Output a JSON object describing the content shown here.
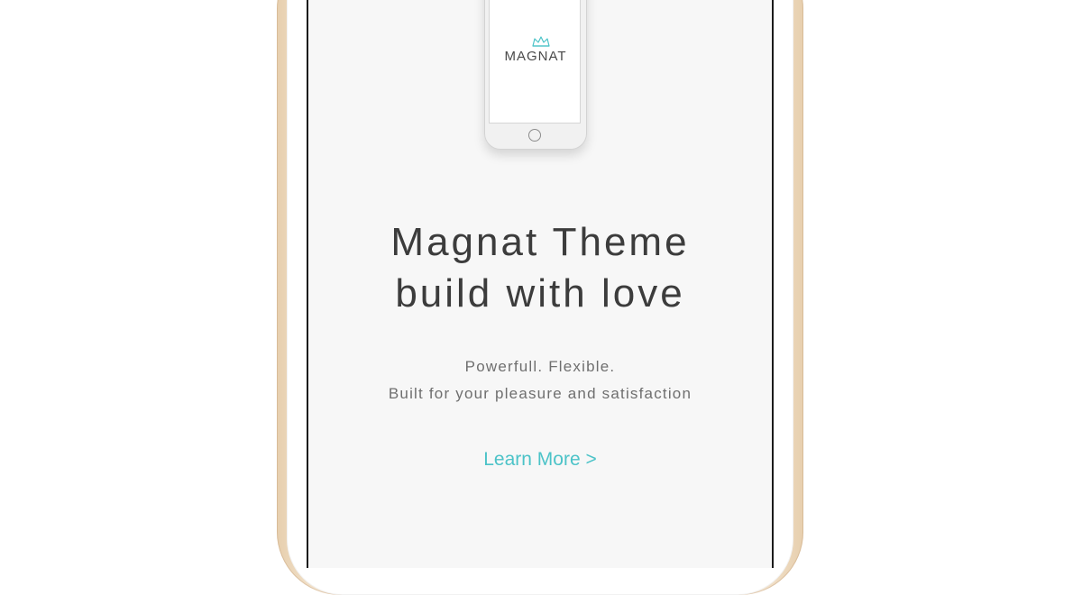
{
  "hero": {
    "brand": {
      "logo_text": "MAGNAT",
      "logo_icon": "crown-icon"
    },
    "title_lines": [
      "Magnat Theme",
      "build with love"
    ],
    "subtitle_lines": [
      "Powerfull. Flexible.",
      "Built for your pleasure and satisfaction"
    ],
    "cta": {
      "label": "Learn More >"
    }
  },
  "colors": {
    "accent": "#4cc3c8",
    "text_dark": "#3c3c3c",
    "text_muted": "#6f6f6f",
    "screen_bg": "#f7f7f7",
    "frame_gold": "#e7cfae"
  }
}
